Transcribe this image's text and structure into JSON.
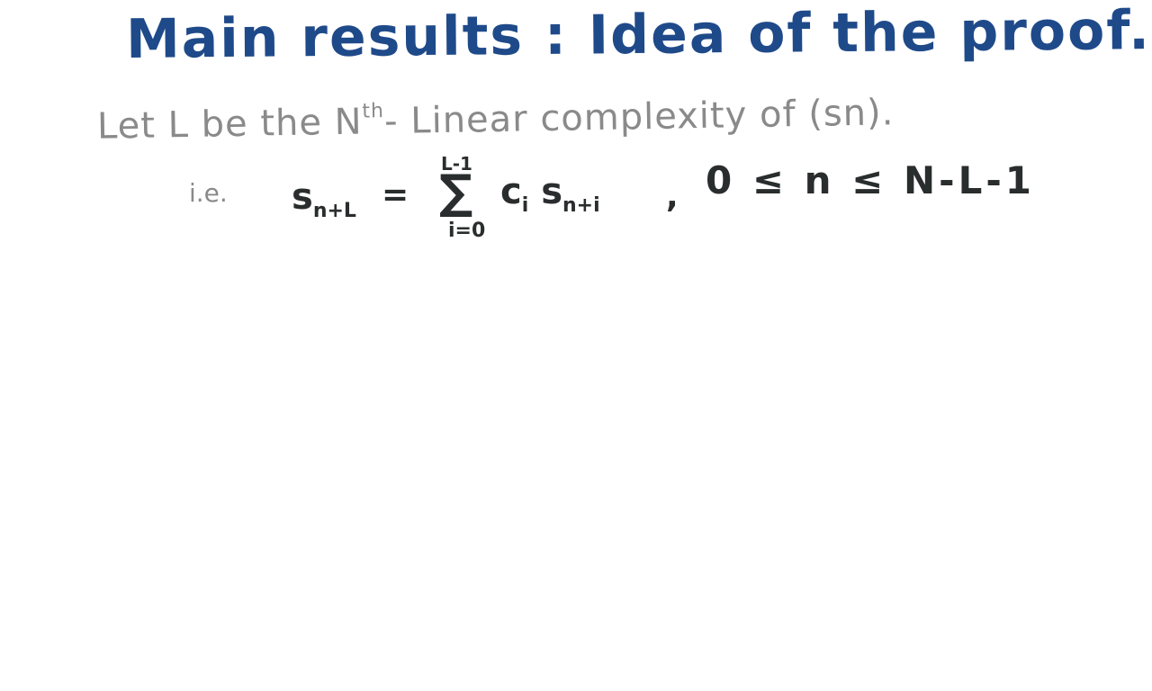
{
  "title": "Main results : Idea of the proof.",
  "line1": {
    "prefix": "Let L be the N",
    "superscript": "th",
    "suffix": "- Linear complexity of (sn)."
  },
  "ie": "i.e.",
  "formula": {
    "lhs_base": "s",
    "lhs_sub": "n+L",
    "equals": "=",
    "sum_upper": "L-1",
    "sum_symbol": "∑",
    "sum_lower": "i=0",
    "coef_base": "c",
    "coef_sub": "i",
    "term_base": "s",
    "term_sub": "n+i",
    "comma": ",",
    "range": "0 ≤ n ≤ N-L-1"
  },
  "colors": {
    "title": "#1f4a8a",
    "text_gray": "#8a8a8a",
    "formula": "#2a2d2d",
    "background": "#ffffff"
  }
}
